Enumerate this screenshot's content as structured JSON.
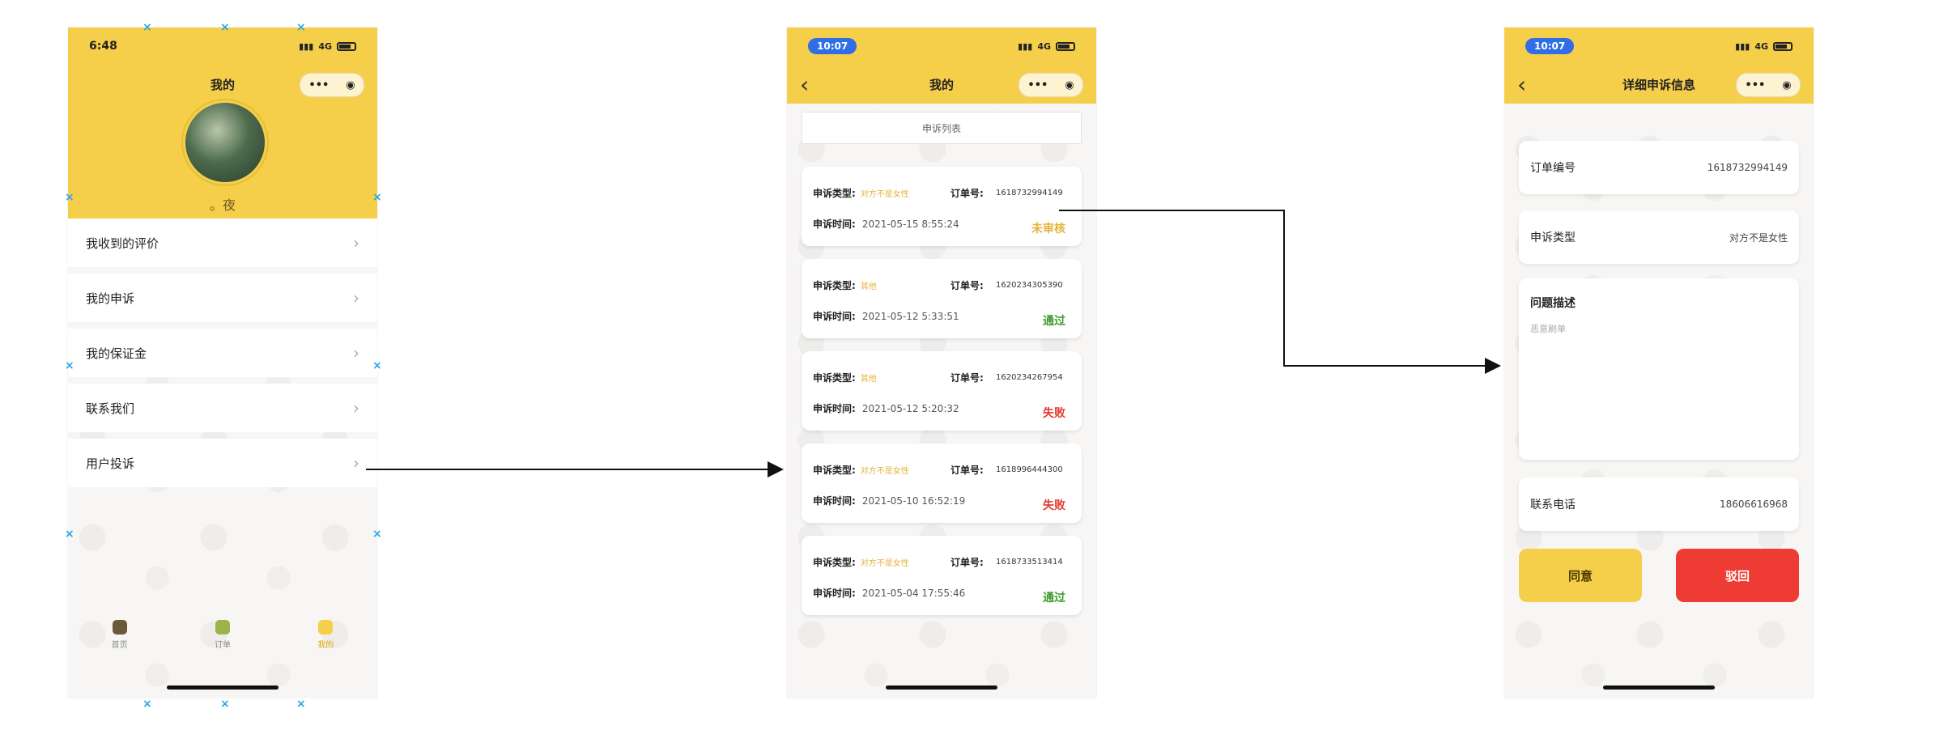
{
  "colors": {
    "accent": "#f6cf4a",
    "pending": "#e6b23a",
    "pass": "#3c9a2c",
    "fail": "#e23a2f",
    "reject_button": "#ee3b33"
  },
  "phone1": {
    "time": "6:48",
    "signal": "4G",
    "title": "我的",
    "nickname": "。夜",
    "menu": [
      "我收到的评价",
      "我的申诉",
      "我的保证金",
      "联系我们",
      "用户投诉"
    ],
    "tabs": [
      {
        "label": "首页",
        "icon": "home-icon"
      },
      {
        "label": "订单",
        "icon": "order-icon"
      },
      {
        "label": "我的",
        "icon": "profile-icon"
      }
    ]
  },
  "phone2": {
    "time": "10:07",
    "signal": "4G",
    "title": "我的",
    "list_title": "申诉列表",
    "type_label": "申诉类型:",
    "order_label": "订单号:",
    "time_label": "申诉时间:",
    "items": [
      {
        "type": "对方不是女性",
        "order": "1618732994149",
        "time": "2021-05-15 8:55:24",
        "status": "未审核"
      },
      {
        "type": "其他",
        "order": "1620234305390",
        "time": "2021-05-12 5:33:51",
        "status": "通过"
      },
      {
        "type": "其他",
        "order": "1620234267954",
        "time": "2021-05-12 5:20:32",
        "status": "失败"
      },
      {
        "type": "对方不是女性",
        "order": "1618996444300",
        "time": "2021-05-10 16:52:19",
        "status": "失败"
      },
      {
        "type": "对方不是女性",
        "order": "1618733513414",
        "time": "2021-05-04 17:55:46",
        "status": "通过"
      }
    ]
  },
  "phone3": {
    "time": "10:07",
    "signal": "4G",
    "title": "详细申诉信息",
    "order_label": "订单编号",
    "order_value": "1618732994149",
    "type_label": "申诉类型",
    "type_value": "对方不是女性",
    "desc_label": "问题描述",
    "desc_placeholder": "恶意刷单",
    "phone_label": "联系电话",
    "phone_value": "18606616968",
    "agree": "同意",
    "reject": "驳回"
  }
}
